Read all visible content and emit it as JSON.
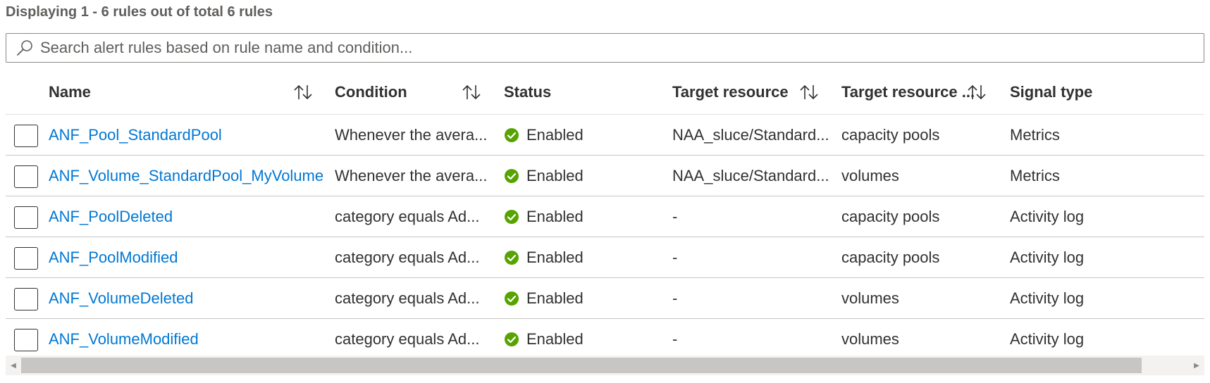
{
  "summary": "Displaying 1 - 6 rules out of total 6 rules",
  "search": {
    "placeholder": "Search alert rules based on rule name and condition...",
    "value": ""
  },
  "columns": {
    "name": "Name",
    "condition": "Condition",
    "status": "Status",
    "target_resource": "Target resource",
    "target_resource_type": "Target resource ...",
    "signal_type": "Signal type"
  },
  "rows": [
    {
      "name": "ANF_Pool_StandardPool",
      "condition": "Whenever the avera...",
      "status": "Enabled",
      "target_resource": "NAA_sluce/Standard...",
      "target_resource_type": "capacity pools",
      "signal_type": "Metrics"
    },
    {
      "name": "ANF_Volume_StandardPool_MyVolume",
      "condition": "Whenever the avera...",
      "status": "Enabled",
      "target_resource": "NAA_sluce/Standard...",
      "target_resource_type": "volumes",
      "signal_type": "Metrics"
    },
    {
      "name": "ANF_PoolDeleted",
      "condition": "category equals Ad...",
      "status": "Enabled",
      "target_resource": "-",
      "target_resource_type": "capacity pools",
      "signal_type": "Activity log"
    },
    {
      "name": "ANF_PoolModified",
      "condition": "category equals Ad...",
      "status": "Enabled",
      "target_resource": "-",
      "target_resource_type": "capacity pools",
      "signal_type": "Activity log"
    },
    {
      "name": "ANF_VolumeDeleted",
      "condition": "category equals Ad...",
      "status": "Enabled",
      "target_resource": "-",
      "target_resource_type": "volumes",
      "signal_type": "Activity log"
    },
    {
      "name": "ANF_VolumeModified",
      "condition": "category equals Ad...",
      "status": "Enabled",
      "target_resource": "-",
      "target_resource_type": "volumes",
      "signal_type": "Activity log"
    }
  ],
  "colors": {
    "link": "#0078d4",
    "status_enabled": "#57a300"
  },
  "icons": {
    "search": "search-icon",
    "sort": "sort-icon",
    "status": "check-circle-icon"
  }
}
